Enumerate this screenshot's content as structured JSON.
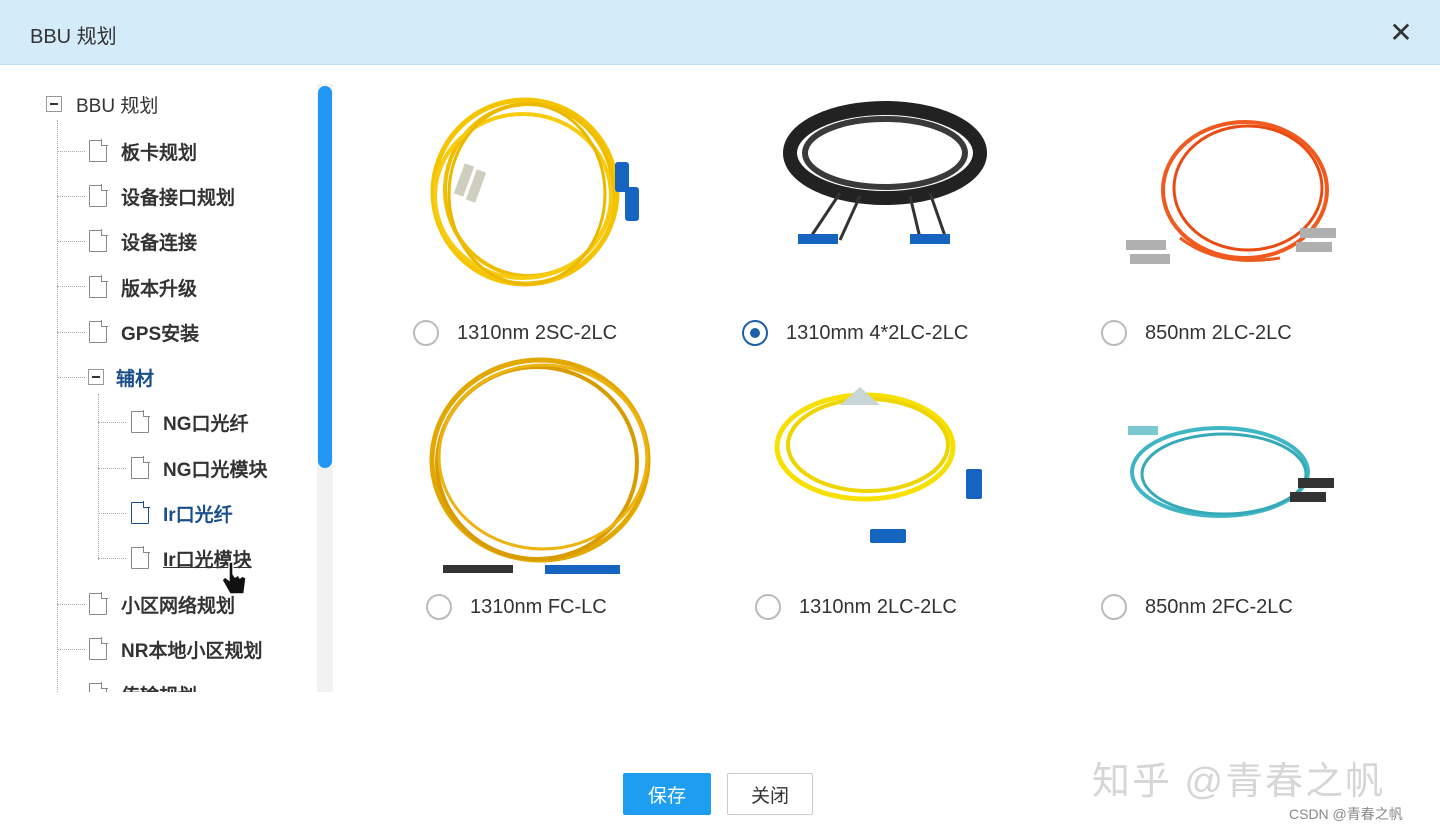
{
  "dialog": {
    "title": "BBU 规划",
    "close_glyph": "✕"
  },
  "tree": {
    "root": "BBU 规划",
    "items": [
      {
        "label": "板卡规划"
      },
      {
        "label": "设备接口规划"
      },
      {
        "label": "设备连接"
      },
      {
        "label": "版本升级"
      },
      {
        "label": "GPS安装"
      },
      {
        "label": "辅材"
      },
      {
        "label": "NG口光纤"
      },
      {
        "label": "NG口光模块"
      },
      {
        "label": "Ir口光纤"
      },
      {
        "label": "Ir口光模块"
      },
      {
        "label": "小区网络规划"
      },
      {
        "label": "NR本地小区规划"
      },
      {
        "label": "传输规划"
      }
    ],
    "selected": "Ir口光纤",
    "hovered": "Ir口光模块"
  },
  "options": [
    {
      "label": "1310nm 2SC-2LC",
      "selected": false,
      "cable_color": "#f5c400",
      "connector_color": "#1565c0"
    },
    {
      "label": "1310mm 4*2LC-2LC",
      "selected": true,
      "cable_color": "#222222",
      "connector_color": "#1565c0"
    },
    {
      "label": "850nm 2LC-2LC",
      "selected": false,
      "cable_color": "#f05a1e",
      "connector_color": "#b0b0b0"
    },
    {
      "label": "1310nm FC-LC",
      "selected": false,
      "cable_color": "#e3a800",
      "connector_color": "#1565c0"
    },
    {
      "label": "1310nm 2LC-2LC",
      "selected": false,
      "cable_color": "#f7e000",
      "connector_color": "#1565c0"
    },
    {
      "label": "850nm 2FC-2LC",
      "selected": false,
      "cable_color": "#3fb6c4",
      "connector_color": "#333333"
    }
  ],
  "buttons": {
    "save": "保存",
    "close": "关闭"
  },
  "watermark": {
    "zhihu": "知乎 @青春之帆",
    "csdn": "CSDN @青春之帆"
  },
  "colors": {
    "titlebar": "#d4ecfa",
    "primary": "#1e9ef0",
    "tree_active": "#1b4f8a"
  }
}
